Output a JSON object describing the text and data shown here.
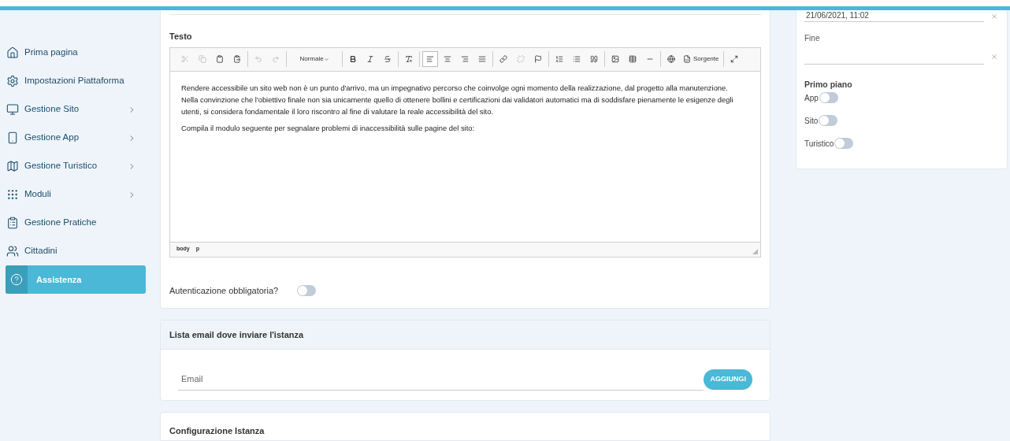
{
  "sidebar": {
    "items": [
      {
        "label": "Prima pagina",
        "has_submenu": false,
        "selected": false
      },
      {
        "label": "Impostazioni Piattaforma",
        "has_submenu": false,
        "selected": false
      },
      {
        "label": "Gestione Sito",
        "has_submenu": true,
        "selected": false
      },
      {
        "label": "Gestione App",
        "has_submenu": true,
        "selected": false
      },
      {
        "label": "Gestione Turistico",
        "has_submenu": true,
        "selected": false
      },
      {
        "label": "Moduli",
        "has_submenu": true,
        "selected": false
      },
      {
        "label": "Gestione Pratiche",
        "has_submenu": false,
        "selected": false
      },
      {
        "label": "Cittadini",
        "has_submenu": false,
        "selected": false
      },
      {
        "label": "Assistenza",
        "has_submenu": false,
        "selected": true
      }
    ]
  },
  "editor": {
    "label": "Testo",
    "toolbar": [
      [
        {
          "kind": "cut",
          "disabled": true
        },
        {
          "kind": "copy",
          "disabled": true
        },
        {
          "kind": "paste",
          "disabled": false
        },
        {
          "kind": "paste-text",
          "disabled": false
        }
      ],
      [
        {
          "kind": "undo",
          "disabled": true
        },
        {
          "kind": "redo",
          "disabled": true
        }
      ],
      [
        {
          "kind": "format",
          "label": "Normale",
          "disabled": false
        }
      ],
      [
        {
          "kind": "bold",
          "disabled": false
        },
        {
          "kind": "italic",
          "disabled": false
        },
        {
          "kind": "strike",
          "disabled": false
        }
      ],
      [
        {
          "kind": "clear-format",
          "disabled": false
        }
      ],
      [
        {
          "kind": "align-left",
          "disabled": false,
          "selected": true
        },
        {
          "kind": "align-center",
          "disabled": false,
          "selected": false
        },
        {
          "kind": "align-right",
          "disabled": false,
          "selected": false
        },
        {
          "kind": "justify",
          "disabled": false,
          "selected": false
        }
      ],
      [
        {
          "kind": "link",
          "disabled": false
        },
        {
          "kind": "unlink",
          "disabled": true
        },
        {
          "kind": "anchor",
          "disabled": false
        }
      ],
      [
        {
          "kind": "numbered-list",
          "disabled": false
        },
        {
          "kind": "bulleted-list",
          "disabled": false
        },
        {
          "kind": "quote",
          "disabled": false
        }
      ],
      [
        {
          "kind": "image",
          "disabled": false
        },
        {
          "kind": "table",
          "disabled": false
        },
        {
          "kind": "rule",
          "disabled": false
        }
      ],
      [
        {
          "kind": "globe",
          "disabled": false
        },
        {
          "kind": "source",
          "label": "Sorgente",
          "disabled": false
        }
      ],
      [
        {
          "kind": "maximize",
          "disabled": false
        }
      ]
    ],
    "paragraphs": [
      [
        "Rendere accessibile un sito web non è un punto d'arrivo, ma un impegnativo percorso che coinvolge ogni momento della realizzazione, dal progetto alla manutenzione.",
        "Nella convinzione che l'obiettivo finale non sia unicamente quello di ottenere bollini e certificazioni dai validatori automatici ma di soddisfare pienamente le esigenze degli utenti, si considera fondamentale il loro riscontro al fine di valutare la reale accessibilità del sito."
      ],
      [
        "Compila il modulo seguente per segnalare problemi di inaccessibilità sulle pagine del sito:"
      ]
    ],
    "path": [
      "body",
      "p"
    ]
  },
  "auth_toggle": {
    "label": "Autenticazione obbligatoria?",
    "on": false
  },
  "email_list": {
    "title": "Lista email dove inviare l'istanza",
    "placeholder": "Email",
    "button": "AGGIUNGI"
  },
  "config": {
    "title": "Configurazione Istanza"
  },
  "side_panel": {
    "start_value": "21/06/2021, 11:02",
    "end_label": "Fine",
    "featured_title": "Primo piano",
    "toggles": [
      {
        "label": "App",
        "on": false
      },
      {
        "label": "Sito",
        "on": false
      },
      {
        "label": "Turistico",
        "on": false
      }
    ]
  }
}
